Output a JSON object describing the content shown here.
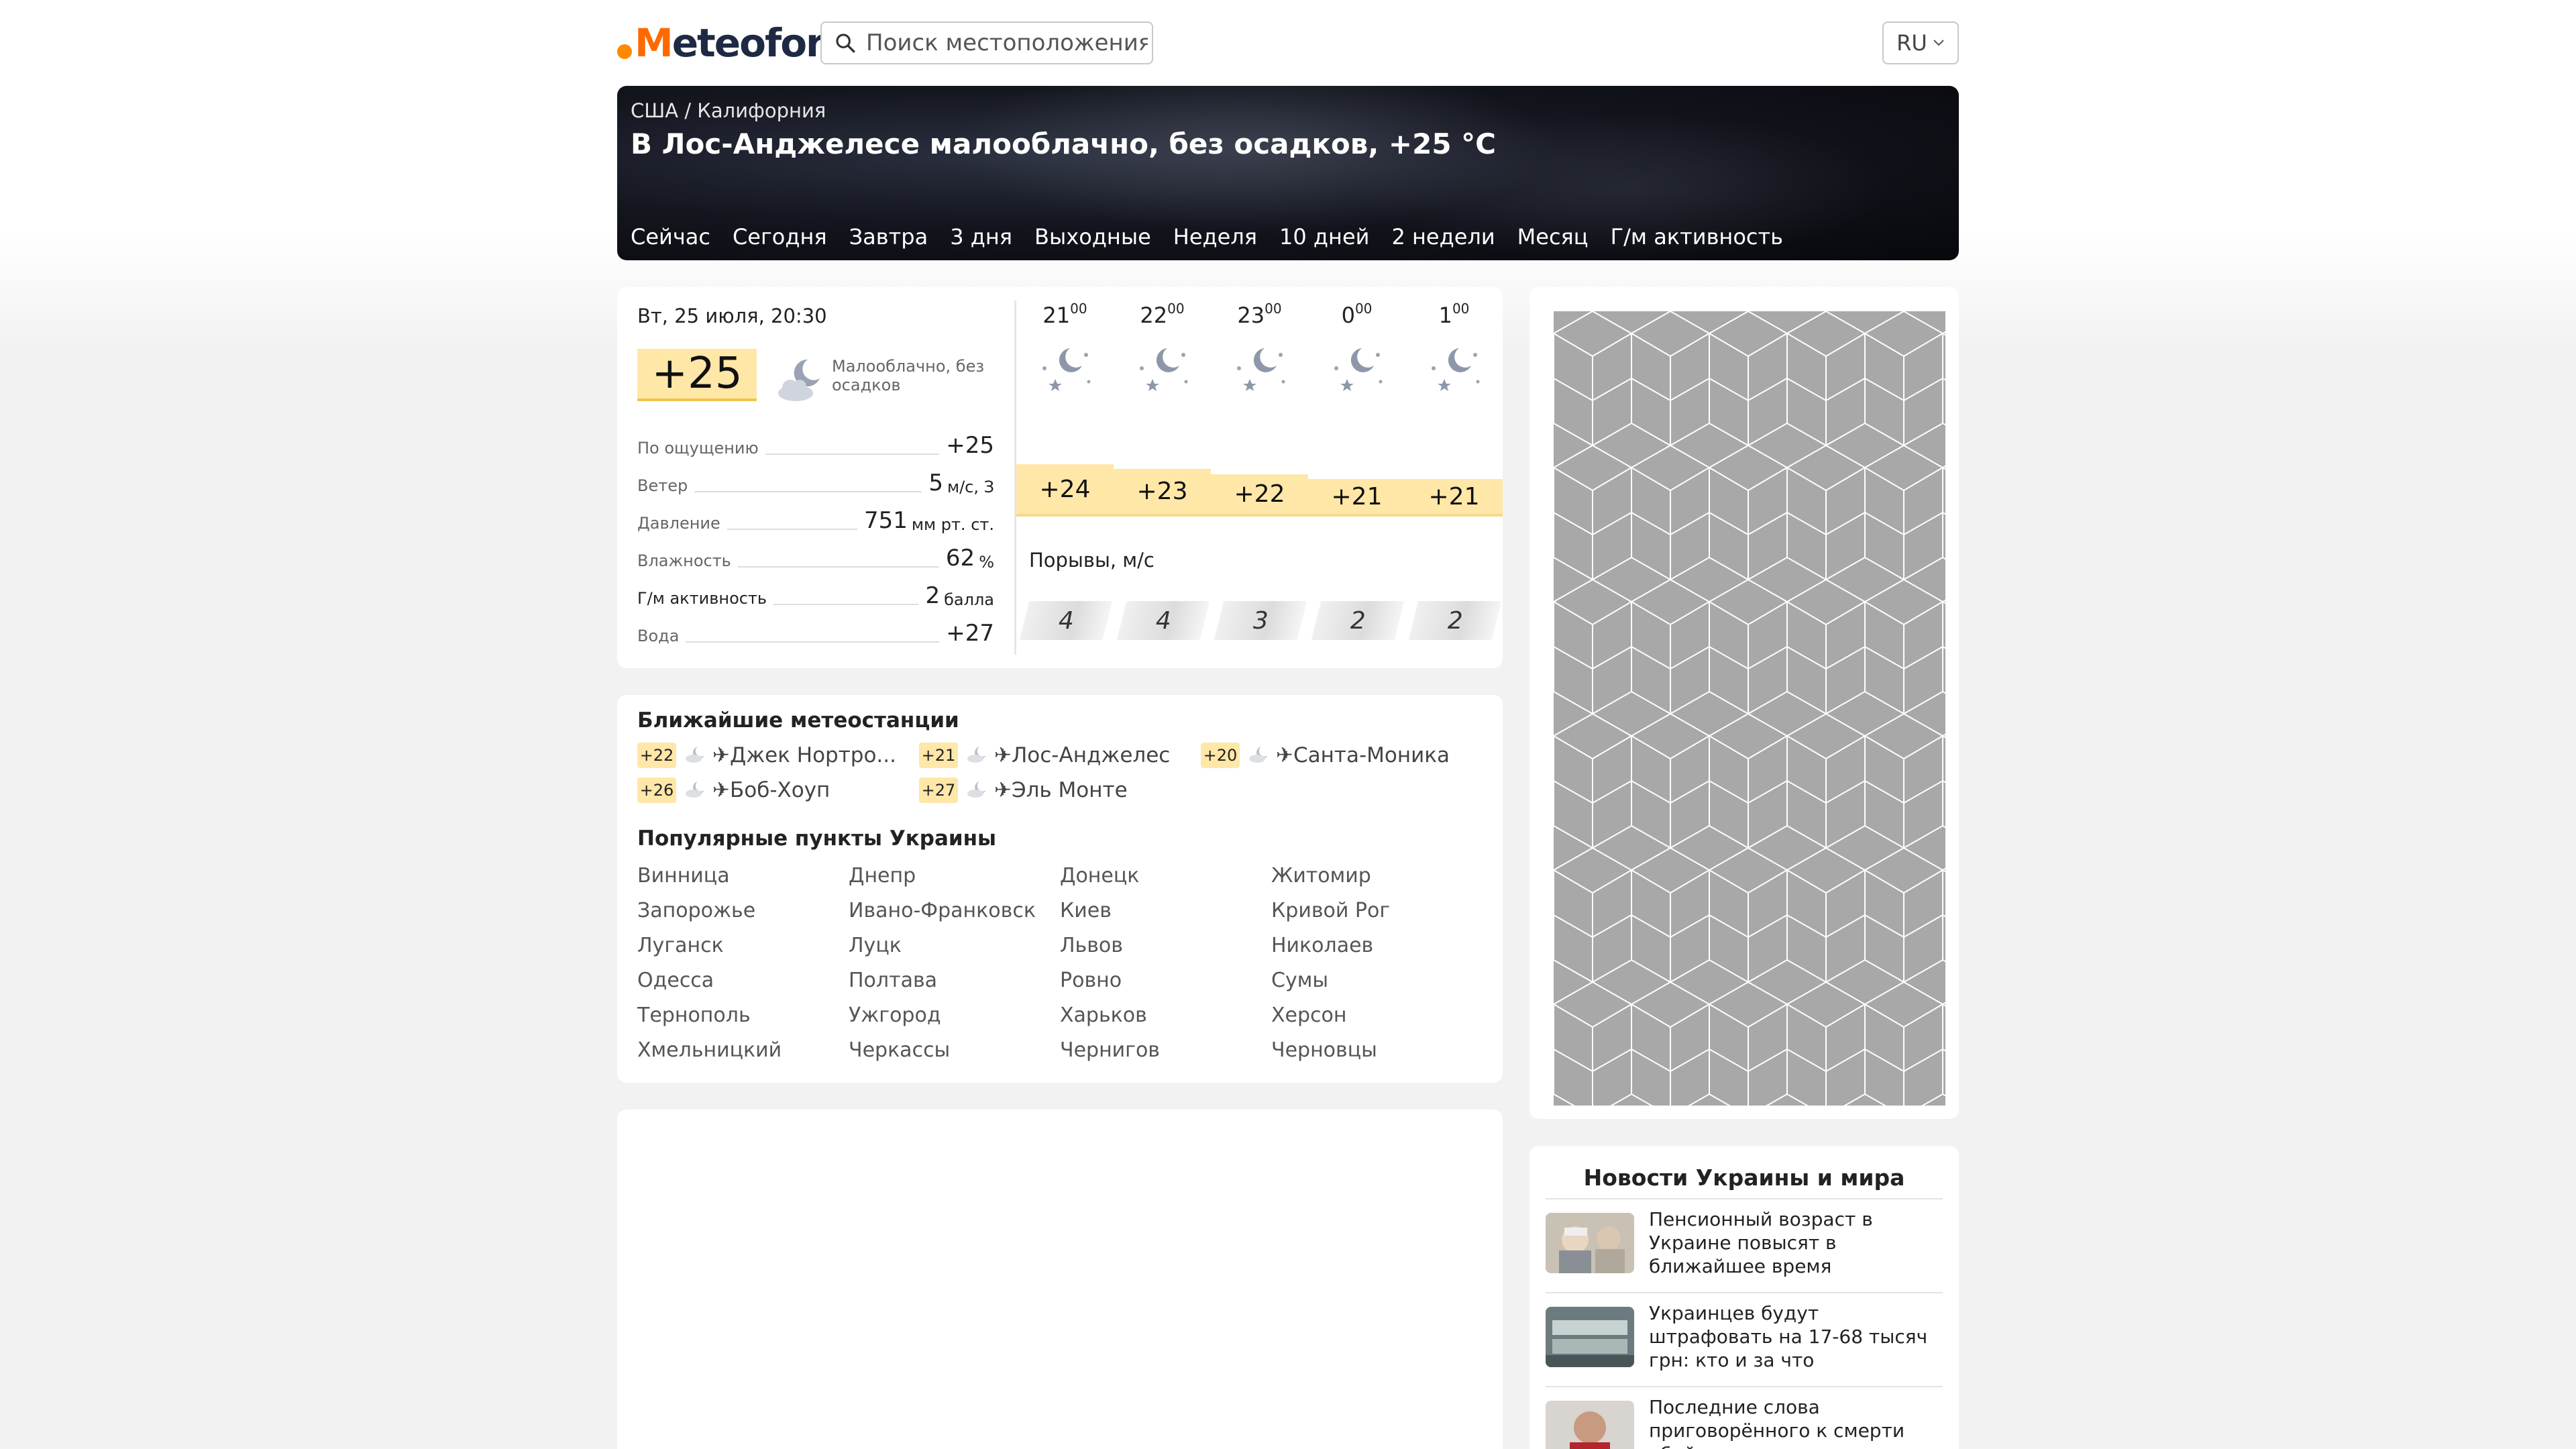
{
  "header": {
    "logo_text": "Meteofor",
    "search_placeholder": "Поиск местоположения",
    "lang": "RU"
  },
  "hero": {
    "breadcrumb": "США / Калифорния",
    "title": "В Лос-Анджелесе малооблачно, без осадков, +25 °C",
    "tabs": [
      "Сейчас",
      "Сегодня",
      "Завтра",
      "3 дня",
      "Выходные",
      "Неделя",
      "10 дней",
      "2 недели",
      "Месяц",
      "Г/м активность"
    ]
  },
  "now": {
    "date": "Вт, 25 июля, 20:30",
    "temp": "+25",
    "condition": "Малооблачно, без осадков",
    "params": [
      {
        "label": "По ощущению",
        "value": "+25",
        "unit": ""
      },
      {
        "label": "Ветер",
        "value": "5",
        "unit": "м/с, З"
      },
      {
        "label": "Давление",
        "value": "751",
        "unit": "мм рт. ст."
      },
      {
        "label": "Влажность",
        "value": "62",
        "unit": "%"
      },
      {
        "label": "Г/м активность",
        "value": "2",
        "unit": "балла"
      },
      {
        "label": "Вода",
        "value": "+27",
        "unit": ""
      }
    ]
  },
  "hourly": {
    "hours": [
      {
        "h": "21",
        "m": "00",
        "temp": "+24",
        "temp_value": 24,
        "gust": "4"
      },
      {
        "h": "22",
        "m": "00",
        "temp": "+23",
        "temp_value": 23,
        "gust": "4"
      },
      {
        "h": "23",
        "m": "00",
        "temp": "+22",
        "temp_value": 22,
        "gust": "3"
      },
      {
        "h": "0",
        "m": "00",
        "temp": "+21",
        "temp_value": 21,
        "gust": "2"
      },
      {
        "h": "1",
        "m": "00",
        "temp": "+21",
        "temp_value": 21,
        "gust": "2"
      }
    ],
    "gust_label": "Порывы, м/с"
  },
  "stations": {
    "title": "Ближайшие метеостанции",
    "items": [
      {
        "temp": "+22",
        "name": "✈Джек Нортро..."
      },
      {
        "temp": "+21",
        "name": "✈Лос-Анджелес"
      },
      {
        "temp": "+20",
        "name": "✈Санта-Моника"
      },
      {
        "temp": "+26",
        "name": "✈Боб-Хоуп"
      },
      {
        "temp": "+27",
        "name": "✈Эль Монте"
      }
    ]
  },
  "popular": {
    "title": "Популярные пункты Украины",
    "cities": [
      "Винница",
      "Днепр",
      "Донецк",
      "Житомир",
      "Запорожье",
      "Ивано-Франковск",
      "Киев",
      "Кривой Рог",
      "Луганск",
      "Луцк",
      "Львов",
      "Николаев",
      "Одесса",
      "Полтава",
      "Ровно",
      "Сумы",
      "Тернополь",
      "Ужгород",
      "Харьков",
      "Херсон",
      "Хмельницкий",
      "Черкассы",
      "Чернигов",
      "Черновцы"
    ]
  },
  "news": {
    "title": "Новости Украины и мира",
    "items": [
      {
        "text": "Пенсионный возраст в Украине повысят в ближайшее время"
      },
      {
        "text": "Украинцев будут штрафовать на 17-68 тысяч грн: кто и за что"
      },
      {
        "text": "Последние слова приговорённого к смерти убийцы вызвали шквал"
      }
    ]
  },
  "colors": {
    "accent_orange": "#ff6a00",
    "temp_badge": "#ffe7a8",
    "hero_bg": "#0b0d14"
  }
}
